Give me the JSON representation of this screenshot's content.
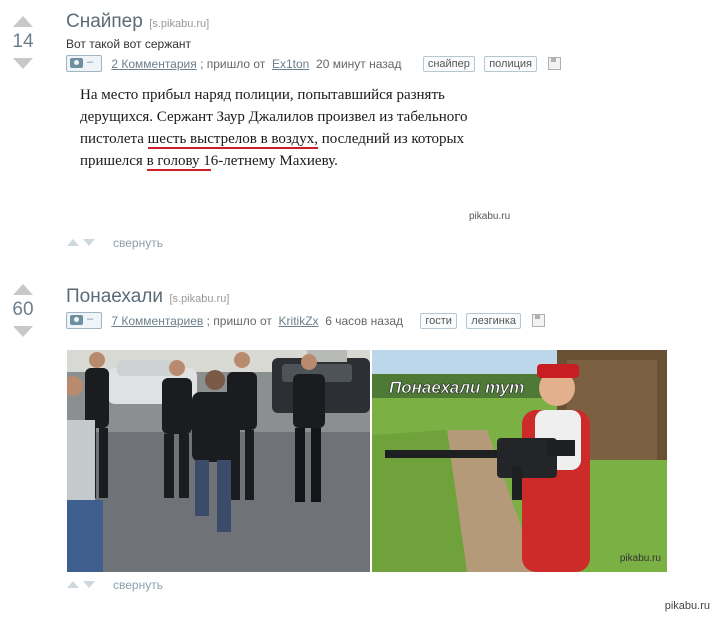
{
  "posts": [
    {
      "rating": "14",
      "title": "Снайпер",
      "source": "[s.pikabu.ru]",
      "subtitle": "Вот такой вот сержант",
      "comments_link": "2 Комментария",
      "from_text": "; пришло от ",
      "author": "Ex1ton",
      "time": " 20 минут назад",
      "tags": [
        "снайпер",
        "полиция"
      ],
      "story": {
        "part1": "На место прибыл наряд полиции, попытавшийся разнять дерущихся. Сержант Заур Джалилов произвел из табельного пистолета ",
        "underline1": "шесть выстрелов в воздух,",
        "part2": " последний из которых пришелся ",
        "underline2": "в голову 1",
        "part3": "6-летнему Махиеву."
      },
      "watermark": "pikabu.ru",
      "collapse_label": "свернуть"
    },
    {
      "rating": "60",
      "title": "Понаехали",
      "source": "[s.pikabu.ru]",
      "comments_link": "7 Комментариев",
      "from_text": "; пришло от ",
      "author": "KritikZx",
      "time": " 6 часов назад",
      "tags": [
        "гости",
        "лезгинка"
      ],
      "image_caption": "Понаехали тут",
      "image_watermark": "pikabu.ru",
      "collapse_label": "свернуть"
    }
  ],
  "footer_watermark": "pikabu.ru"
}
